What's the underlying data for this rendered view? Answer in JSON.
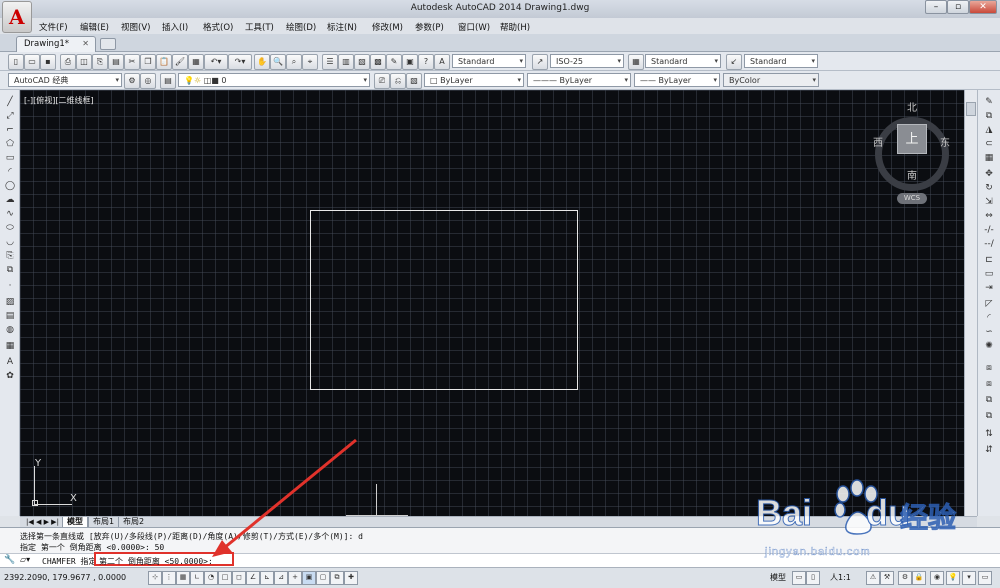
{
  "window": {
    "title": "Autodesk AutoCAD 2014     Drawing1.dwg",
    "controls": [
      "?",
      "▫",
      "✕"
    ]
  },
  "menu": [
    "文件(F)",
    "编辑(E)",
    "视图(V)",
    "插入(I)",
    "格式(O)",
    "工具(T)",
    "绘图(D)",
    "标注(N)",
    "修改(M)",
    "参数(P)",
    "窗口(W)",
    "帮助(H)"
  ],
  "tabs": {
    "active": "Drawing1*",
    "close": "✕"
  },
  "toolbar1": {
    "text_style": "Standard",
    "dim_style": "ISO-25",
    "table_style": "Standard",
    "mleader_style": "Standard"
  },
  "toolbar2": {
    "workspace": "AutoCAD 经典",
    "layer": "0",
    "color": "ByLayer",
    "linetype": "ByLayer",
    "lineweight": "ByLayer",
    "plotstyle": "ByColor"
  },
  "viewport": {
    "label": "[-][俯视][二维线框]",
    "viewcube": {
      "top": "上",
      "north": "北",
      "south": "南",
      "east": "东",
      "west": "西"
    },
    "wcs": "WCS",
    "ucs": {
      "x": "X",
      "y": "Y"
    }
  },
  "layouts": [
    "模型",
    "布局1",
    "布局2"
  ],
  "command": {
    "history1": "选择第一条直线或 [放弃(U)/多段线(P)/距离(D)/角度(A)/修剪(T)/方式(E)/多个(M)]: d",
    "history2": "指定 第一个 倒角距离 <0.0000>: 50",
    "prompt_prefix": "CHAMFER 指定",
    "prompt": "第二个 倒角距离 <50.0000>:"
  },
  "status": {
    "coords": "2392.2090, 179.9677 , 0.0000",
    "model": "模型",
    "scale": "人1:1"
  },
  "watermark": {
    "brand": "Bai",
    "brand2": "du",
    "cn": "经验",
    "url": "jingyan.baidu.com"
  },
  "colors": {
    "canvas": "#0b0d11",
    "highlight": "#e0322b",
    "baidu_blue": "#2d5fb3"
  }
}
